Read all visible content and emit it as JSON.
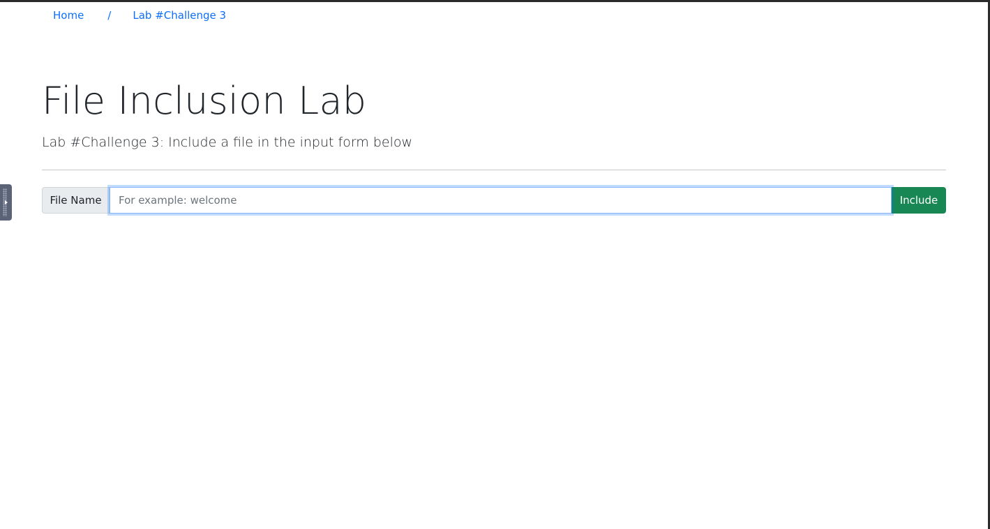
{
  "breadcrumb": {
    "home": "Home",
    "separator": "/",
    "current": "Lab #Challenge 3"
  },
  "header": {
    "title": "File Inclusion Lab",
    "subtitle": "Lab #Challenge 3: Include a file in the input form below"
  },
  "form": {
    "label": "File Name",
    "input_value": "",
    "input_placeholder": "For example: welcome",
    "submit_label": "Include"
  },
  "colors": {
    "link": "#0d6efd",
    "submit_button": "#198754",
    "focus_border": "#86b7fe"
  },
  "icons": {
    "side_handle": "play-arrow-icon"
  }
}
